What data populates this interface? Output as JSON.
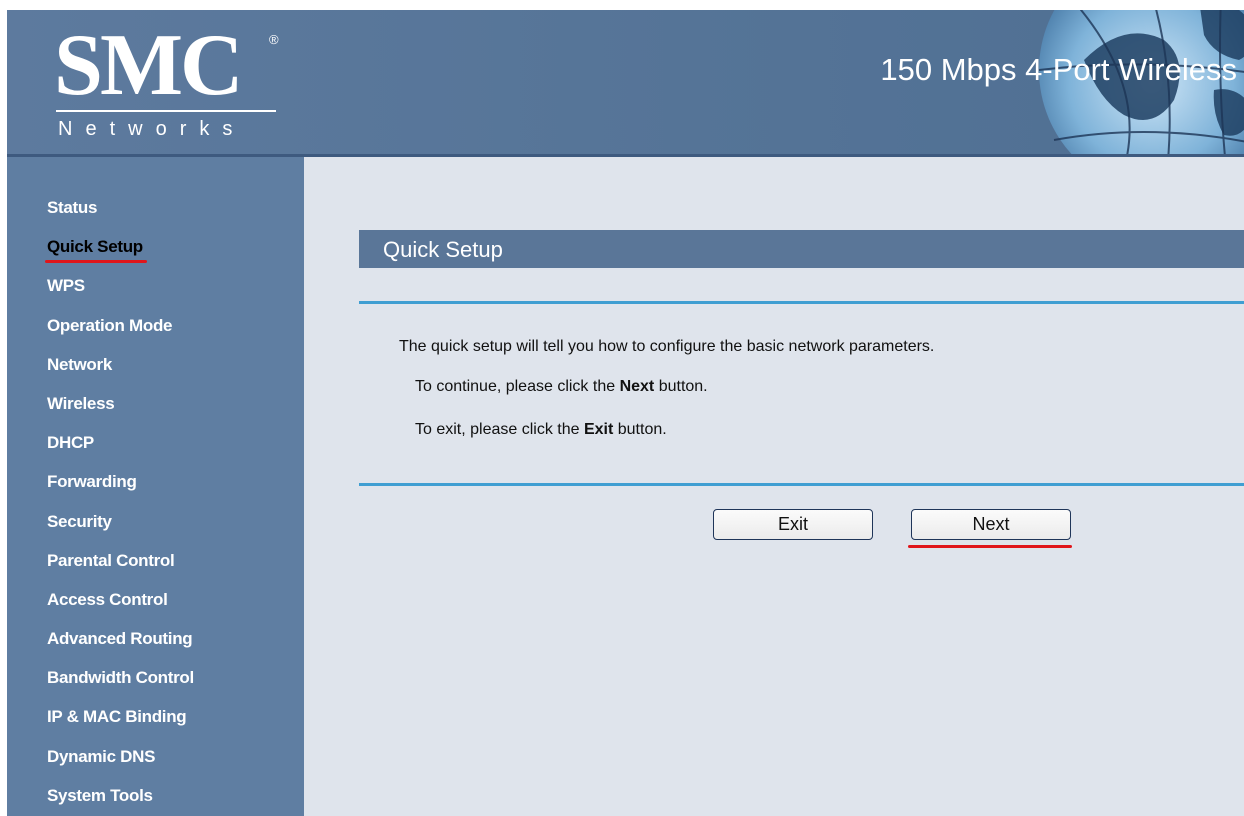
{
  "header": {
    "logo_text": "SMC",
    "logo_registered": "®",
    "logo_subtext": "Networks",
    "product_title": "150 Mbps 4-Port Wireless"
  },
  "sidebar": {
    "items": [
      {
        "label": "Status",
        "active": false
      },
      {
        "label": "Quick Setup",
        "active": true
      },
      {
        "label": "WPS",
        "active": false
      },
      {
        "label": "Operation Mode",
        "active": false
      },
      {
        "label": "Network",
        "active": false
      },
      {
        "label": "Wireless",
        "active": false
      },
      {
        "label": "DHCP",
        "active": false
      },
      {
        "label": "Forwarding",
        "active": false
      },
      {
        "label": "Security",
        "active": false
      },
      {
        "label": "Parental Control",
        "active": false
      },
      {
        "label": "Access Control",
        "active": false
      },
      {
        "label": "Advanced Routing",
        "active": false
      },
      {
        "label": "Bandwidth Control",
        "active": false
      },
      {
        "label": "IP & MAC Binding",
        "active": false
      },
      {
        "label": "Dynamic DNS",
        "active": false
      },
      {
        "label": "System Tools",
        "active": false
      }
    ]
  },
  "main": {
    "title": "Quick Setup",
    "intro": "The quick setup will tell you how to configure the basic network parameters.",
    "continue_prefix": "To continue, please click the ",
    "continue_bold": "Next",
    "continue_suffix": " button.",
    "exit_prefix": "To exit, please click the ",
    "exit_bold": "Exit",
    "exit_suffix": " button.",
    "exit_button": "Exit",
    "next_button": "Next"
  },
  "colors": {
    "header_bg": "#557497",
    "sidebar_bg": "#5f7ea2",
    "main_bg": "#dfe4ec",
    "title_bar": "#5a7698",
    "divider": "#3f9ed2",
    "highlight_underline": "#e0161b"
  },
  "icons": {
    "header_graphic": "globe-icon"
  }
}
